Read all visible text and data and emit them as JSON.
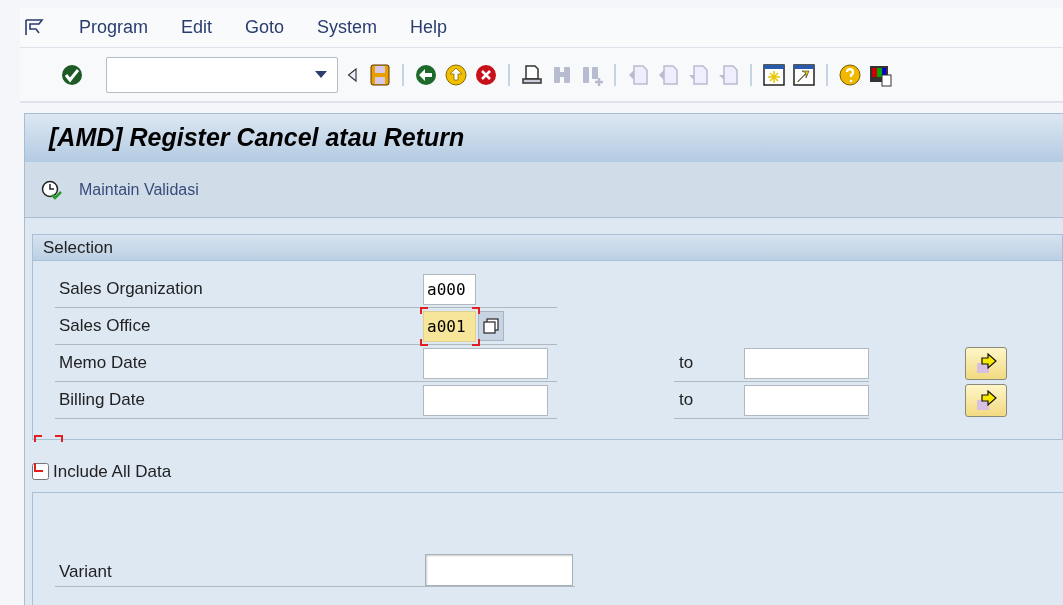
{
  "menu_bar": {
    "items": [
      {
        "label": "Program"
      },
      {
        "label": "Edit"
      },
      {
        "label": "Goto"
      },
      {
        "label": "System"
      },
      {
        "label": "Help"
      }
    ]
  },
  "title": "[AMD] Register Cancel atau Return",
  "app_toolbar": {
    "buttons": [
      {
        "label": "Maintain Validasi"
      }
    ]
  },
  "selection": {
    "title": "Selection",
    "rows": [
      {
        "label": "Sales Organization",
        "low": "a000",
        "focused": false,
        "kind": "single"
      },
      {
        "label": "Sales Office",
        "low": "a001",
        "focused": true,
        "kind": "multi"
      },
      {
        "label": "Memo Date",
        "low": "",
        "focused": false,
        "kind": "range",
        "to_label": "to",
        "high": ""
      },
      {
        "label": "Billing Date",
        "low": "",
        "focused": false,
        "kind": "range",
        "to_label": "to",
        "high": ""
      }
    ]
  },
  "include_all": {
    "label": "Include All Data",
    "checked": false,
    "focused": true
  },
  "variant": {
    "label": "Variant"
  }
}
